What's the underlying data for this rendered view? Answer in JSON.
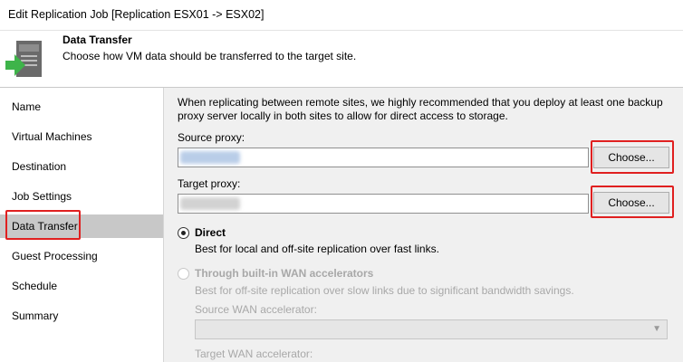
{
  "window": {
    "title": "Edit Replication Job [Replication ESX01 -> ESX02]"
  },
  "header": {
    "title": "Data Transfer",
    "description": "Choose how VM data should be transferred to the target site.",
    "icon": "data-transfer-icon"
  },
  "sidebar": {
    "items": [
      {
        "label": "Name",
        "active": false
      },
      {
        "label": "Virtual Machines",
        "active": false
      },
      {
        "label": "Destination",
        "active": false
      },
      {
        "label": "Job Settings",
        "active": false
      },
      {
        "label": "Data Transfer",
        "active": true
      },
      {
        "label": "Guest Processing",
        "active": false
      },
      {
        "label": "Schedule",
        "active": false
      },
      {
        "label": "Summary",
        "active": false
      }
    ]
  },
  "main": {
    "intro": "When replicating between remote sites, we highly recommended that you deploy at least one backup proxy server locally in both sites to allow for direct access to storage.",
    "source_proxy": {
      "label": "Source proxy:",
      "button": "Choose..."
    },
    "target_proxy": {
      "label": "Target proxy:",
      "button": "Choose..."
    },
    "options": {
      "direct": {
        "title": "Direct",
        "description": "Best for local and off-site replication over fast links.",
        "selected": true
      },
      "wan": {
        "title": "Through built-in WAN accelerators",
        "description": "Best for off-site replication over slow links due to significant bandwidth savings.",
        "selected": false,
        "enabled": false
      }
    },
    "source_wan": {
      "label": "Source WAN accelerator:",
      "value": ""
    },
    "target_wan": {
      "label": "Target WAN accelerator:"
    }
  },
  "colors": {
    "highlight": "#e02020",
    "active_item": "#c8c8c8",
    "panel": "#f0f0f0"
  }
}
